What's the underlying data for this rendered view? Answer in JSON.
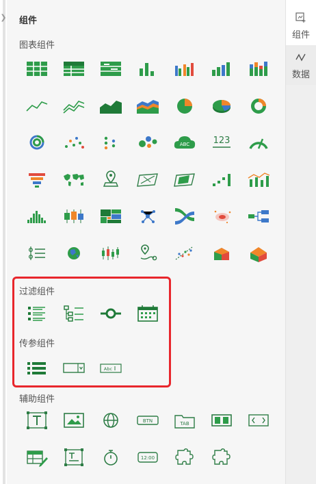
{
  "panel": {
    "title": "组件"
  },
  "sidebar": {
    "tabs": [
      {
        "label": "组件",
        "icon": "add-component-icon",
        "active": true
      },
      {
        "label": "数据",
        "icon": "data-line-icon",
        "active": false
      }
    ]
  },
  "sections": {
    "chart": {
      "title": "图表组件"
    },
    "filter": {
      "title": "过滤组件"
    },
    "param": {
      "title": "传参组件"
    },
    "aux": {
      "title": "辅助组件"
    }
  },
  "icon_labels": {
    "text_123": "123",
    "text_abc_badge": "ABC",
    "text_btn": "BTN",
    "text_tab": "TAB",
    "text_time": "12:00",
    "text_abc_input": "Abc"
  },
  "colors": {
    "green": "#2e9c4a",
    "darkgreen": "#1f7a38",
    "blue": "#3d78c9",
    "orange": "#f0862a",
    "red": "#e14b3d",
    "highlight": "#e8262c"
  }
}
